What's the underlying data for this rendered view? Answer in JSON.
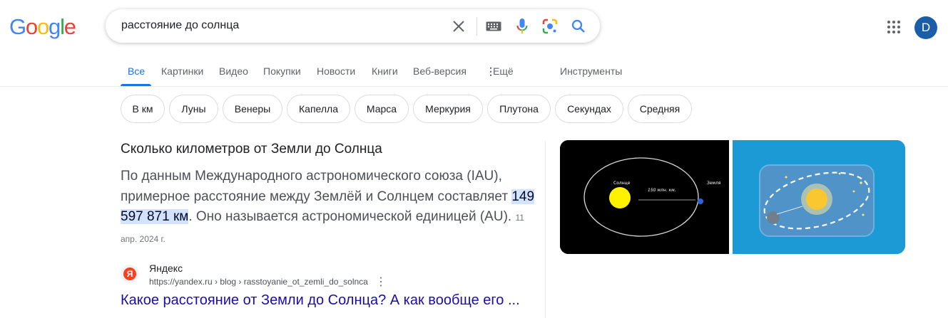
{
  "logo": {
    "letters": [
      "G",
      "o",
      "o",
      "g",
      "l",
      "e"
    ],
    "colors": [
      "#4285f4",
      "#ea4335",
      "#fbbc05",
      "#4285f4",
      "#34a853",
      "#ea4335"
    ]
  },
  "search": {
    "query": "расстояние до солнца"
  },
  "account": {
    "initial": "D"
  },
  "tabs": [
    {
      "label": "Все"
    },
    {
      "label": "Картинки"
    },
    {
      "label": "Видео"
    },
    {
      "label": "Покупки"
    },
    {
      "label": "Новости"
    },
    {
      "label": "Книги"
    },
    {
      "label": "Веб-версия"
    },
    {
      "label": "Ещё"
    },
    {
      "label": "Инструменты"
    }
  ],
  "chips": [
    {
      "label": "В км"
    },
    {
      "label": "Луны"
    },
    {
      "label": "Венеры"
    },
    {
      "label": "Капелла"
    },
    {
      "label": "Марса"
    },
    {
      "label": "Меркурия"
    },
    {
      "label": "Плутона"
    },
    {
      "label": "Секундах"
    },
    {
      "label": "Средняя"
    }
  ],
  "answer": {
    "heading": "Сколько километров от Земли до Солнца",
    "text_before": "По данным Международного астрономического союза (IAU), примерное расстояние между Землёй и Солнцем составляет ",
    "highlight": "149 597 871 км",
    "text_after": ". Оно называется астрономической единицей (AU).",
    "date": "11 апр. 2024 г."
  },
  "source": {
    "favicon_letter": "Я",
    "name": "Яндекс",
    "url": "https://yandex.ru › blog › rasstoyanie_ot_zemli_do_solnca",
    "title": "Какое расстояние от Земли до Солнца? А как вообще его ..."
  },
  "image1": {
    "sun_label": "Солнце",
    "distance_label": "150 млн. км.",
    "earth_label": "Земля"
  },
  "colors": {
    "accent": "#1a73e8",
    "link": "#1a0dab",
    "highlight": "#d3e3fd",
    "avatar": "#1a5da8"
  }
}
